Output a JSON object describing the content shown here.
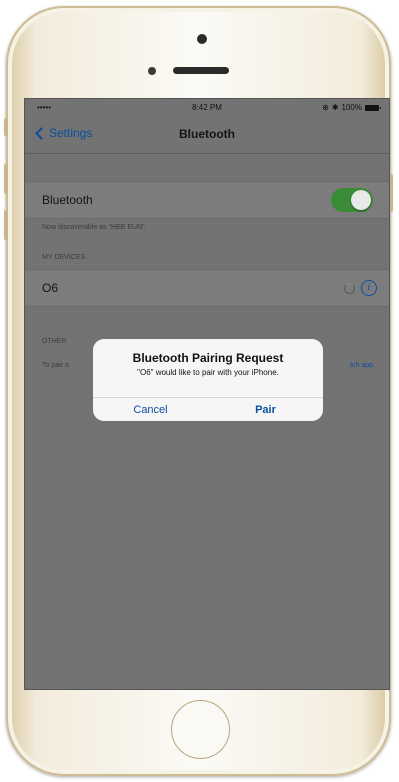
{
  "status_bar": {
    "signal": "•••••",
    "time": "8:42 PM",
    "battery": "100%",
    "battery_icon": "battery-full-icon",
    "bluetooth_icon": "bluetooth-icon",
    "alarm_icon": "alarm-icon"
  },
  "nav": {
    "back_label": "Settings",
    "back_icon": "chevron-left-icon",
    "title": "Bluetooth"
  },
  "bluetooth": {
    "label": "Bluetooth",
    "enabled": true,
    "toggle_color": "#3a8c36",
    "discoverable_text": "Now discoverable as \"HEE EUN\"."
  },
  "my_devices": {
    "header": "MY DEVICES",
    "items": [
      {
        "name": "O6",
        "status_icon": "spinner-icon",
        "info_icon": "info-icon"
      }
    ]
  },
  "other_devices": {
    "header": "OTHER",
    "instruction_prefix": "To pair a",
    "instruction_link": "tch app."
  },
  "alert": {
    "title": "Bluetooth Pairing Request",
    "message": "\"O6\" would like to pair with your iPhone.",
    "cancel_label": "Cancel",
    "pair_label": "Pair"
  },
  "colors": {
    "accent": "#0a4ea0",
    "dim_background": "#737373"
  }
}
